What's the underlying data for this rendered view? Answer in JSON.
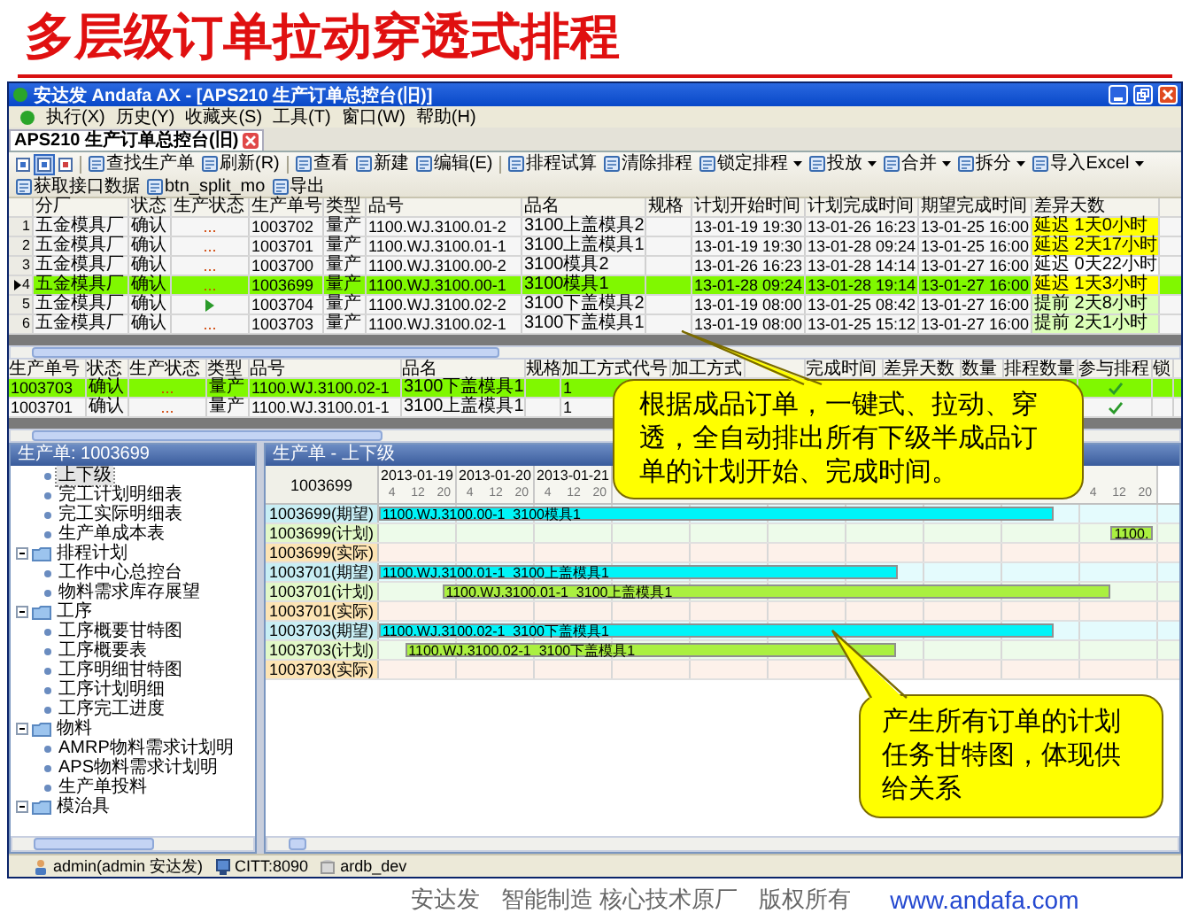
{
  "page_title": "多层级订单拉动穿透式排程",
  "window": {
    "title": "安达发 Andafa AX - [APS210 生产订单总控台(旧)]"
  },
  "menu": [
    {
      "label": "执行(X)"
    },
    {
      "label": "历史(Y)"
    },
    {
      "label": "收藏夹(S)"
    },
    {
      "label": "工具(T)"
    },
    {
      "label": "窗口(W)"
    },
    {
      "label": "帮助(H)"
    }
  ],
  "tabs": [
    {
      "label": "APS210 生产订单总控台(旧)",
      "selected": true
    }
  ],
  "toolbar": [
    {
      "kind": "icon",
      "selected": false
    },
    {
      "kind": "icon",
      "selected": true
    },
    {
      "kind": "icon",
      "selected": false
    },
    {
      "kind": "separator"
    },
    {
      "kind": "button",
      "label": "查找生产单",
      "dropdown": false
    },
    {
      "kind": "button",
      "label": "刷新(R)",
      "dropdown": false
    },
    {
      "kind": "separator"
    },
    {
      "kind": "button",
      "label": "查看",
      "dropdown": false
    },
    {
      "kind": "button",
      "label": "新建",
      "dropdown": false
    },
    {
      "kind": "button",
      "label": "编辑(E)",
      "dropdown": false
    },
    {
      "kind": "separator"
    },
    {
      "kind": "button",
      "label": "排程试算",
      "dropdown": false
    },
    {
      "kind": "button",
      "label": "清除排程",
      "dropdown": false
    },
    {
      "kind": "button",
      "label": "锁定排程",
      "dropdown": true
    },
    {
      "kind": "button",
      "label": "投放",
      "dropdown": true
    },
    {
      "kind": "button",
      "label": "合并",
      "dropdown": true
    },
    {
      "kind": "button",
      "label": "拆分",
      "dropdown": true
    },
    {
      "kind": "button",
      "label": "导入Excel",
      "dropdown": true
    },
    {
      "kind": "button",
      "label": "获取接口数据",
      "dropdown": false
    },
    {
      "kind": "button",
      "label": "btn_split_mo",
      "dropdown": false
    },
    {
      "kind": "button",
      "label": "导出",
      "dropdown": false
    }
  ],
  "orders": {
    "columns": [
      "分厂",
      "状态",
      "生产状态",
      "生产单号",
      "类型",
      "品号",
      "品名",
      "规格",
      "计划开始时间",
      "计划完成时间",
      "期望完成时间",
      "差异天数"
    ],
    "rows": [
      {
        "row": "1",
        "selected": false,
        "plant": "五金模具厂",
        "status": "确认",
        "prod_state": {
          "kind": "text",
          "text": "..."
        },
        "order_no": "1003702",
        "type": "量产",
        "part_no": "1100.WJ.3100.01-2",
        "part_name": "3100上盖模具2",
        "plan_start": "13-01-19 19:30",
        "plan_end": "13-01-26 16:23",
        "due": "13-01-25 16:00",
        "diff": {
          "text": "延迟 1天0小时",
          "color": "#ffff00"
        }
      },
      {
        "row": "2",
        "selected": false,
        "plant": "五金模具厂",
        "status": "确认",
        "prod_state": {
          "kind": "text",
          "text": "..."
        },
        "order_no": "1003701",
        "type": "量产",
        "part_no": "1100.WJ.3100.01-1",
        "part_name": "3100上盖模具1",
        "plan_start": "13-01-19 19:30",
        "plan_end": "13-01-28 09:24",
        "due": "13-01-25 16:00",
        "diff": {
          "text": "延迟 2天17小时",
          "color": "#ffff00"
        }
      },
      {
        "row": "3",
        "selected": false,
        "plant": "五金模具厂",
        "status": "确认",
        "prod_state": {
          "kind": "text",
          "text": "..."
        },
        "order_no": "1003700",
        "type": "量产",
        "part_no": "1100.WJ.3100.00-2",
        "part_name": "3100模具2",
        "plan_start": "13-01-26 16:23",
        "plan_end": "13-01-28 14:14",
        "due": "13-01-27 16:00",
        "diff": {
          "text": "延迟 0天22小时",
          "color": "#ffffff"
        }
      },
      {
        "row": "4",
        "selected": true,
        "plant": "五金模具厂",
        "status": "确认",
        "prod_state": {
          "kind": "text",
          "text": "..."
        },
        "order_no": "1003699",
        "type": "量产",
        "part_no": "1100.WJ.3100.00-1",
        "part_name": "3100模具1",
        "plan_start": "13-01-28 09:24",
        "plan_end": "13-01-28 19:14",
        "due": "13-01-27 16:00",
        "diff": {
          "text": "延迟 1天3小时",
          "color": "#ffff00"
        }
      },
      {
        "row": "5",
        "selected": false,
        "plant": "五金模具厂",
        "status": "确认",
        "prod_state": {
          "kind": "play"
        },
        "order_no": "1003704",
        "type": "量产",
        "part_no": "1100.WJ.3100.02-2",
        "part_name": "3100下盖模具2",
        "plan_start": "13-01-19 08:00",
        "plan_end": "13-01-25 08:42",
        "due": "13-01-27 16:00",
        "diff": {
          "text": "提前 2天8小时",
          "color": "#dcffb8"
        }
      },
      {
        "row": "6",
        "selected": false,
        "plant": "五金模具厂",
        "status": "确认",
        "prod_state": {
          "kind": "text",
          "text": "..."
        },
        "order_no": "1003703",
        "type": "量产",
        "part_no": "1100.WJ.3100.02-1",
        "part_name": "3100下盖模具1",
        "plan_start": "13-01-19 08:00",
        "plan_end": "13-01-25 15:12",
        "due": "13-01-27 16:00",
        "diff": {
          "text": "提前 2天1小时",
          "color": "#dcffb8"
        }
      }
    ]
  },
  "components": {
    "columns": [
      "生产单号",
      "状态",
      "生产状态",
      "类型",
      "品号",
      "品名",
      "规格",
      "加工方式代号",
      "加工方式",
      "完成时间",
      "差异天数",
      "数量",
      "排程数量",
      "参与排程",
      "锁"
    ],
    "rows": [
      {
        "selected": true,
        "order_no": "1003703",
        "status": "确认",
        "prod_state": "...",
        "type": "量产",
        "part_no": "1100.WJ.3100.02-1",
        "part_name": "3100下盖模具1",
        "method_code": "1",
        "scheduled": true
      },
      {
        "selected": false,
        "order_no": "1003701",
        "status": "确认",
        "prod_state": "...",
        "type": "量产",
        "part_no": "1100.WJ.3100.01-1",
        "part_name": "3100上盖模具1",
        "method_code": "1",
        "scheduled": true
      }
    ]
  },
  "tree": {
    "title": "生产单: 1003699",
    "items": [
      {
        "kind": "leaf",
        "label": "上下级",
        "selected": true
      },
      {
        "kind": "leaf",
        "label": "完工计划明细表",
        "selected": false
      },
      {
        "kind": "leaf",
        "label": "完工实际明细表",
        "selected": false
      },
      {
        "kind": "leaf",
        "label": "生产单成本表",
        "selected": false
      },
      {
        "kind": "folder",
        "label": "排程计划",
        "selected": false,
        "expanded": true,
        "children": [
          {
            "label": "工作中心总控台",
            "selected": false
          },
          {
            "label": "物料需求库存展望",
            "selected": false
          }
        ]
      },
      {
        "kind": "folder",
        "label": "工序",
        "selected": false,
        "expanded": true,
        "children": [
          {
            "label": "工序概要甘特图",
            "selected": false
          },
          {
            "label": "工序概要表",
            "selected": false
          },
          {
            "label": "工序明细甘特图",
            "selected": false
          },
          {
            "label": "工序计划明细",
            "selected": false
          },
          {
            "label": "工序完工进度",
            "selected": false
          }
        ]
      },
      {
        "kind": "folder",
        "label": "物料",
        "selected": false,
        "expanded": true,
        "children": [
          {
            "label": "AMRP物料需求计划明",
            "selected": false
          },
          {
            "label": "APS物料需求计划明",
            "selected": false
          },
          {
            "label": "生产单投料",
            "selected": false
          }
        ]
      },
      {
        "kind": "folder",
        "label": "模治具",
        "selected": false,
        "expanded": true
      }
    ]
  },
  "gantt": {
    "title": "生产单 - 上下级",
    "corner": "1003699",
    "days": [
      {
        "date": "2013-01-19",
        "hours": [
          "4",
          "12",
          "20"
        ]
      },
      {
        "date": "2013-01-20",
        "hours": [
          "4",
          "12",
          "20"
        ]
      },
      {
        "date": "2013-01-21",
        "hours": [
          "4",
          "12",
          "20"
        ]
      },
      {
        "hours": [
          "4",
          "12",
          "20"
        ]
      }
    ],
    "rows": [
      {
        "label": "1003699(期望)",
        "kind": "expected",
        "bar": {
          "text": "1100.WJ.3100.00-1  3100模具1"
        }
      },
      {
        "label": "1003699(计划)",
        "kind": "planned",
        "bar": {
          "text": "1100."
        }
      },
      {
        "label": "1003699(实际)",
        "kind": "actual"
      },
      {
        "label": "1003701(期望)",
        "kind": "expected",
        "bar": {
          "text": "1100.WJ.3100.01-1  3100上盖模具1"
        }
      },
      {
        "label": "1003701(计划)",
        "kind": "planned",
        "bar": {
          "text": "1100.WJ.3100.01-1  3100上盖模具1"
        }
      },
      {
        "label": "1003701(实际)",
        "kind": "actual"
      },
      {
        "label": "1003703(期望)",
        "kind": "expected",
        "bar": {
          "text": "1100.WJ.3100.02-1  3100下盖模具1"
        }
      },
      {
        "label": "1003703(计划)",
        "kind": "planned",
        "bar": {
          "text": "1100.WJ.3100.02-1  3100下盖模具1"
        }
      },
      {
        "label": "1003703(实际)",
        "kind": "actual"
      }
    ]
  },
  "status_bar": [
    "admin(admin 安达发)",
    "CITT:8090",
    "ardb_dev"
  ],
  "callouts": [
    {
      "text": "根据成品订单，一键式、拉动、穿透，全自动排出所有下级半成品订单的计划开始、完成时间。"
    },
    {
      "text": "产生所有订单的计划任务甘特图，体现供给关系"
    }
  ],
  "footer": {
    "texts": [
      "安达发",
      "智能制造 核心技术原厂",
      "版权所有"
    ],
    "link": "www.andafa.com"
  }
}
